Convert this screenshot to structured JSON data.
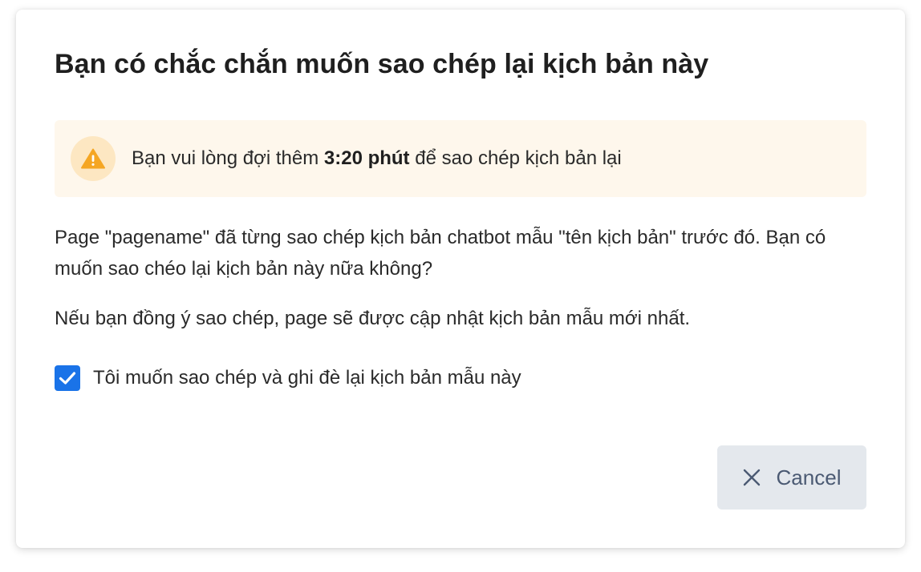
{
  "dialog": {
    "title": "Bạn có chắc chắn muốn sao chép lại kịch bản này",
    "alert": {
      "icon": "warning-icon",
      "text_before": "Bạn vui lòng đợi thêm ",
      "time": "3:20 phút",
      "text_after": " để sao chép kịch bản lại",
      "colors": {
        "background": "#fef7ec",
        "icon_circle": "#fde7c2",
        "icon": "#f5a623"
      }
    },
    "paragraph1": "Page \"pagename\" đã từng sao chép kịch bản chatbot mẫu \"tên kịch bản\" trước đó. Bạn có muốn sao chéo lại kịch bản này nữa không?",
    "paragraph2": "Nếu bạn đồng ý sao chép, page sẽ được cập nhật kịch bản mẫu mới nhất.",
    "checkbox": {
      "label": "Tôi muốn sao chép và ghi đè lại kịch bản mẫu này",
      "checked": true,
      "color": "#1a73e8"
    },
    "cancel_button": {
      "label": "Cancel",
      "icon": "close-icon"
    }
  }
}
